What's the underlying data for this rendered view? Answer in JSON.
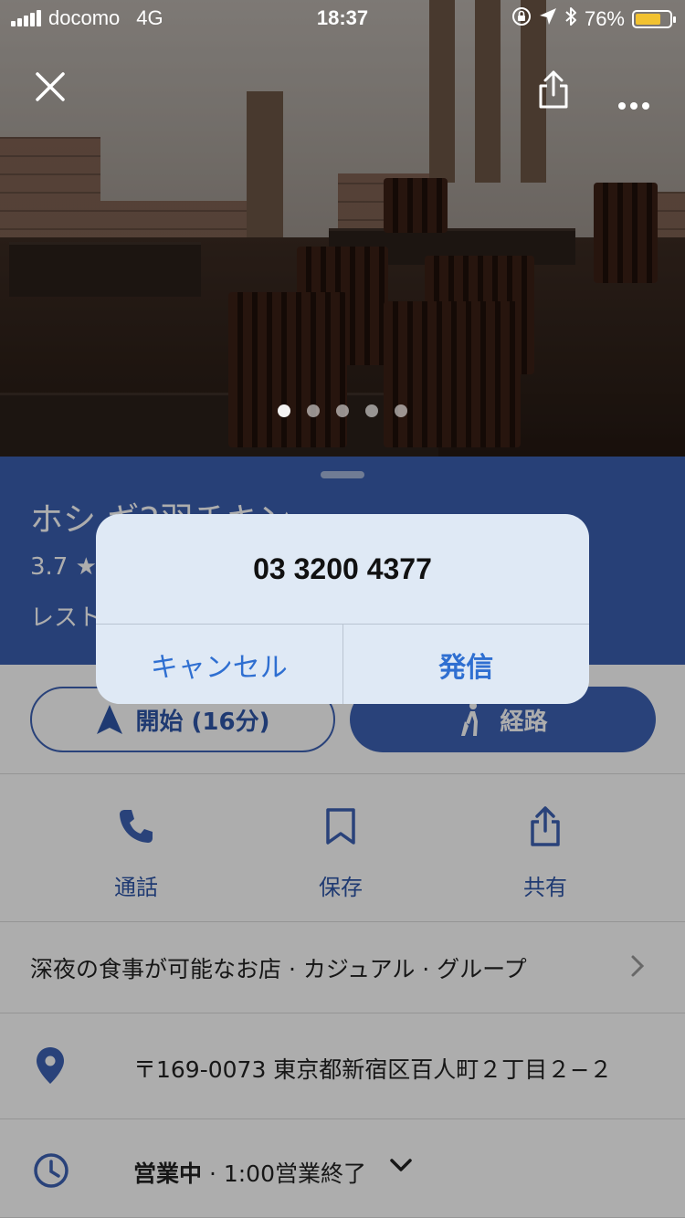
{
  "status_bar": {
    "carrier": "docomo",
    "network": "4G",
    "time": "18:37",
    "battery": "76%",
    "battery_level": 0.76
  },
  "gallery": {
    "dot_count": 5,
    "active_dot": 0
  },
  "place": {
    "name": "ホシ ギ2羽チキン",
    "rating": "3.7 ★",
    "category": "レスト"
  },
  "buttons": {
    "start": "開始 (16分)",
    "route": "経路"
  },
  "quick_actions": {
    "call": "通話",
    "save": "保存",
    "share": "共有"
  },
  "details": {
    "tags": "深夜の食事が可能なお店 · カジュアル · グループ",
    "address": "〒169-0073 東京都新宿区百人町２丁目２−２",
    "hours_status": "営業中",
    "hours_detail": " · 1:00営業終了"
  },
  "alert": {
    "phone": "03 3200 4377",
    "cancel": "キャンセル",
    "call": "発信"
  },
  "colors": {
    "header_blue": "#3a5fb0",
    "accent_blue": "#2f56a8",
    "alert_link": "#2f6fd1"
  }
}
